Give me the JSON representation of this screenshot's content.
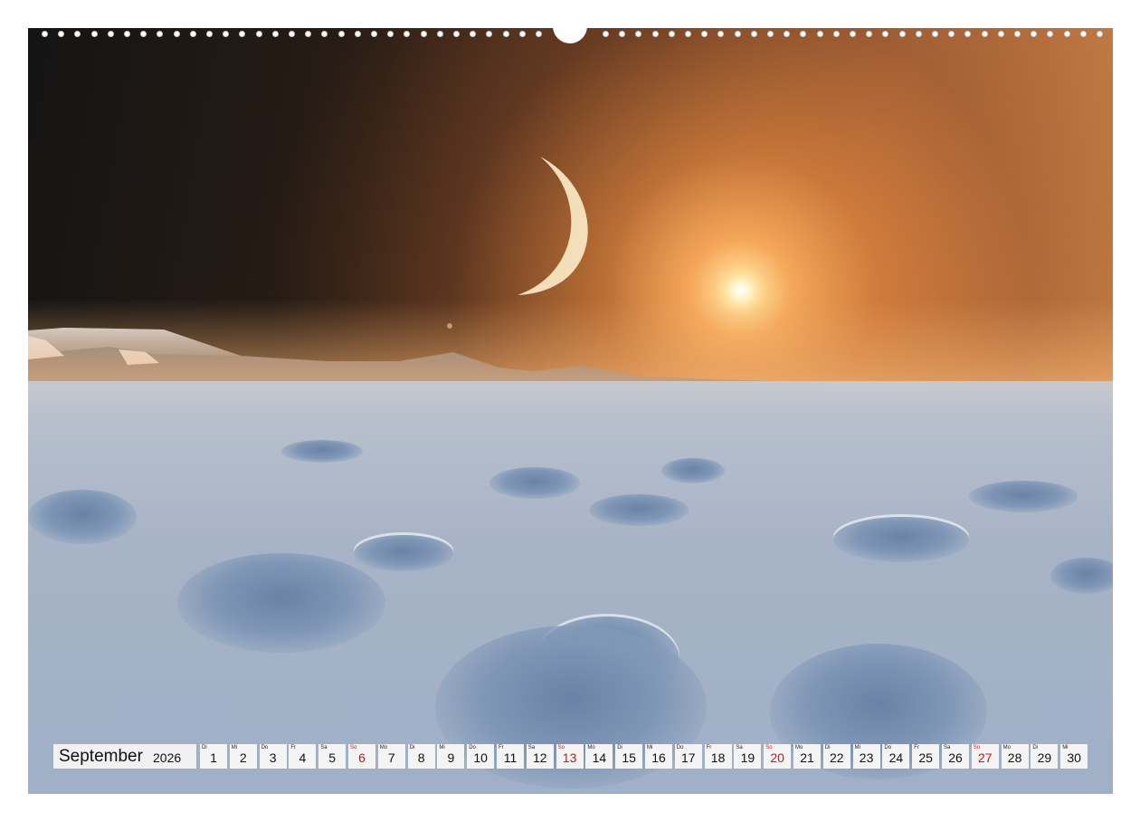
{
  "calendar": {
    "month": "September",
    "year": "2026",
    "days": [
      {
        "weekday": "Di",
        "day": "1",
        "sunday": false
      },
      {
        "weekday": "Mi",
        "day": "2",
        "sunday": false
      },
      {
        "weekday": "Do",
        "day": "3",
        "sunday": false
      },
      {
        "weekday": "Fr",
        "day": "4",
        "sunday": false
      },
      {
        "weekday": "Sa",
        "day": "5",
        "sunday": false
      },
      {
        "weekday": "So",
        "day": "6",
        "sunday": true
      },
      {
        "weekday": "Mo",
        "day": "7",
        "sunday": false
      },
      {
        "weekday": "Di",
        "day": "8",
        "sunday": false
      },
      {
        "weekday": "Mi",
        "day": "9",
        "sunday": false
      },
      {
        "weekday": "Do",
        "day": "10",
        "sunday": false
      },
      {
        "weekday": "Fr",
        "day": "11",
        "sunday": false
      },
      {
        "weekday": "Sa",
        "day": "12",
        "sunday": false
      },
      {
        "weekday": "So",
        "day": "13",
        "sunday": true
      },
      {
        "weekday": "Mo",
        "day": "14",
        "sunday": false
      },
      {
        "weekday": "Di",
        "day": "15",
        "sunday": false
      },
      {
        "weekday": "Mi",
        "day": "16",
        "sunday": false
      },
      {
        "weekday": "Do",
        "day": "17",
        "sunday": false
      },
      {
        "weekday": "Fr",
        "day": "18",
        "sunday": false
      },
      {
        "weekday": "Sa",
        "day": "19",
        "sunday": false
      },
      {
        "weekday": "So",
        "day": "20",
        "sunday": true
      },
      {
        "weekday": "Mo",
        "day": "21",
        "sunday": false
      },
      {
        "weekday": "Di",
        "day": "22",
        "sunday": false
      },
      {
        "weekday": "Mi",
        "day": "23",
        "sunday": false
      },
      {
        "weekday": "Do",
        "day": "24",
        "sunday": false
      },
      {
        "weekday": "Fr",
        "day": "25",
        "sunday": false
      },
      {
        "weekday": "Sa",
        "day": "26",
        "sunday": false
      },
      {
        "weekday": "So",
        "day": "27",
        "sunday": true
      },
      {
        "weekday": "Mo",
        "day": "28",
        "sunday": false
      },
      {
        "weekday": "Di",
        "day": "29",
        "sunday": false
      },
      {
        "weekday": "Mi",
        "day": "30",
        "sunday": false
      }
    ]
  },
  "colors": {
    "sunday": "#c0181e",
    "cell_background": "#f4f4f4",
    "sky_dark": "#141414",
    "sun_glow": "#f5a85a",
    "snow": "#a7b3c6"
  },
  "icons": {
    "binding": "wire-binding-holes",
    "hanger": "calendar-hanger-notch"
  }
}
